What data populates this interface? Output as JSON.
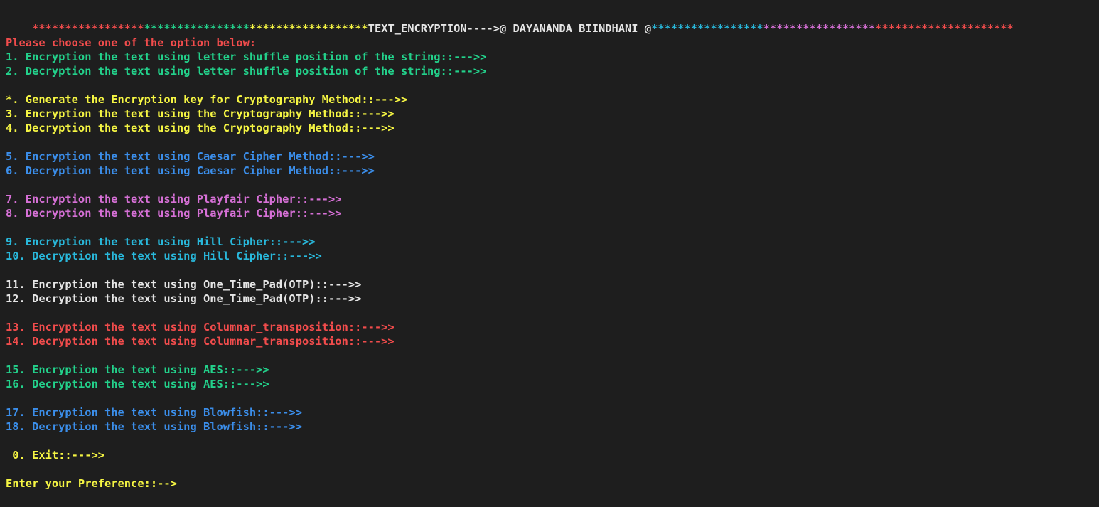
{
  "colors": {
    "background": "#1e1e1e",
    "red": "#f14c4c",
    "green": "#23d18b",
    "yellow": "#f5f543",
    "blue": "#3b8eea",
    "magenta": "#d670d6",
    "cyan": "#29b8db",
    "white": "#e5e5e5"
  },
  "banner": {
    "stars_red": "*****************",
    "stars_green": "****************",
    "stars_yellow": "******************",
    "title": "TEXT_ENCRYPTION---->@ DAYANANDA BIINDHANI @",
    "stars_cyan": "*****************",
    "stars_magenta": "*****************",
    "stars_red_end": "*********************"
  },
  "menu": {
    "prompt_heading": "Please choose one of the option below:",
    "groups": [
      {
        "color": "green",
        "items": [
          "1. Encryption the text using letter shuffle position of the string::--->>",
          "2. Decryption the text using letter shuffle position of the string::--->>"
        ]
      },
      {
        "color": "yellow",
        "items": [
          "*. Generate the Encryption key for Cryptography Method::--->>",
          "3. Encryption the text using the Cryptography Method::--->>",
          "4. Decryption the text using the Cryptography Method::--->>"
        ]
      },
      {
        "color": "blue",
        "items": [
          "5. Encryption the text using Caesar Cipher Method::--->>",
          "6. Decryption the text using Caesar Cipher Method::--->>"
        ]
      },
      {
        "color": "magenta",
        "items": [
          "7. Encryption the text using Playfair Cipher::--->>",
          "8. Decryption the text using Playfair Cipher::--->>"
        ]
      },
      {
        "color": "cyan",
        "items": [
          "9. Encryption the text using Hill Cipher::--->>",
          "10. Decryption the text using Hill Cipher::--->>"
        ]
      },
      {
        "color": "white",
        "items": [
          "11. Encryption the text using One_Time_Pad(OTP)::--->>",
          "12. Decryption the text using One_Time_Pad(OTP)::--->>"
        ]
      },
      {
        "color": "red",
        "items": [
          "13. Encryption the text using Columnar_transposition::--->>",
          "14. Decryption the text using Columnar_transposition::--->>"
        ]
      },
      {
        "color": "green",
        "items": [
          "15. Encryption the text using AES::--->>",
          "16. Decryption the text using AES::--->>"
        ]
      },
      {
        "color": "blue",
        "items": [
          "17. Encryption the text using Blowfish::--->>",
          "18. Decryption the text using Blowfish::--->>"
        ]
      }
    ],
    "exit_label": " 0. Exit::--->>",
    "input_prompt": "Enter your Preference::-->"
  }
}
